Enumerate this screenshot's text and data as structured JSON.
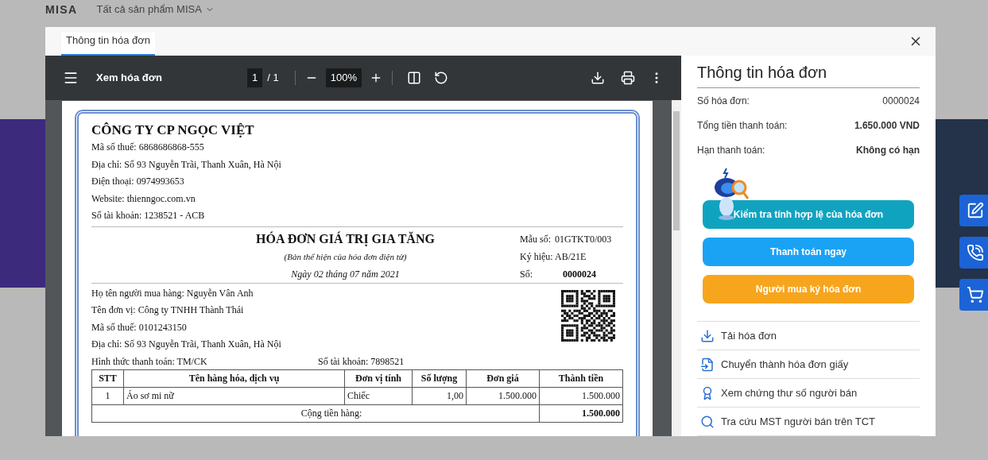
{
  "background": {
    "logo": "MISA",
    "menu": "Tất cả sản phẩm MISA"
  },
  "dialog": {
    "tabs": [
      {
        "label": "Thông tin hóa đơn",
        "selected": true
      }
    ]
  },
  "viewer": {
    "title": "Xem hóa đơn",
    "page_input": "1",
    "page_count": "/ 1",
    "zoom": "100%"
  },
  "invoice": {
    "seller_name": "CÔNG TY CP NGỌC VIỆT",
    "seller_lines": [
      "Mã số thuế: 6868686868-555",
      "Địa chỉ: Số 93 Nguyễn Trãi, Thanh Xuân, Hà Nội",
      "Điện thoại: 0974993653",
      "Website: thienngoc.com.vn",
      "Số tài khoản: 1238521 - ACB"
    ],
    "title": "HÓA ĐƠN GIÁ TRỊ GIA TĂNG",
    "subtitle": "(Bản thể hiện của hóa đơn điện tử)",
    "date": "Ngày 02 tháng 07 năm 2021",
    "meta": [
      {
        "label": "Mẫu số:",
        "value": "01GTKT0/003",
        "emphasis": false
      },
      {
        "label": "Ký hiệu:",
        "value": "AB/21E",
        "emphasis": false
      },
      {
        "label": "Số:",
        "value": "0000024",
        "emphasis": true
      }
    ],
    "buyer_lines": [
      "Họ tên người mua hàng: Nguyễn Vân Anh",
      "Tên đơn vị: Công ty TNHH Thành Thái",
      "Mã số thuế: 0101243150",
      "Địa chỉ: Số 93 Nguyễn Trãi, Thanh Xuân, Hà Nội"
    ],
    "payment": "Hình thức thanh toán: TM/CK",
    "account": "Số tài khoản: 7898521",
    "table": {
      "columns": [
        "STT",
        "Tên hàng hóa, dịch vụ",
        "Đơn vị tính",
        "Số lượng",
        "Đơn giá",
        "Thành tiền"
      ],
      "rows": [
        [
          "1",
          "Áo sơ mi nữ",
          "Chiếc",
          "1,00",
          "1.500.000",
          "1.500.000"
        ]
      ],
      "total_label": "Cộng tiền hàng:",
      "total_value": "1.500.000"
    }
  },
  "info": {
    "title": "Thông tin hóa đơn",
    "fields": [
      {
        "label": "Số hóa đơn:",
        "value": "0000024",
        "emphasis": false
      },
      {
        "label": "Tổng tiền thanh toán:",
        "value": "1.650.000 VND",
        "emphasis": true
      },
      {
        "label": "Hạn thanh toán:",
        "value": "Không có hạn",
        "emphasis": true
      }
    ],
    "buttons": [
      {
        "label": "Kiểm tra tính hợp lệ của hóa đơn",
        "kind": "check"
      },
      {
        "label": "Thanh toán ngay",
        "kind": "pay"
      },
      {
        "label": "Người mua ký hóa đơn",
        "kind": "sign"
      }
    ],
    "links": [
      {
        "label": "Tải hóa đơn",
        "kind": "download"
      },
      {
        "label": "Chuyển thành hóa đơn giấy",
        "kind": "convert"
      },
      {
        "label": "Xem chứng thư số người bán",
        "kind": "certificate"
      },
      {
        "label": "Tra cứu MST người bán trên TCT",
        "kind": "search"
      }
    ]
  }
}
